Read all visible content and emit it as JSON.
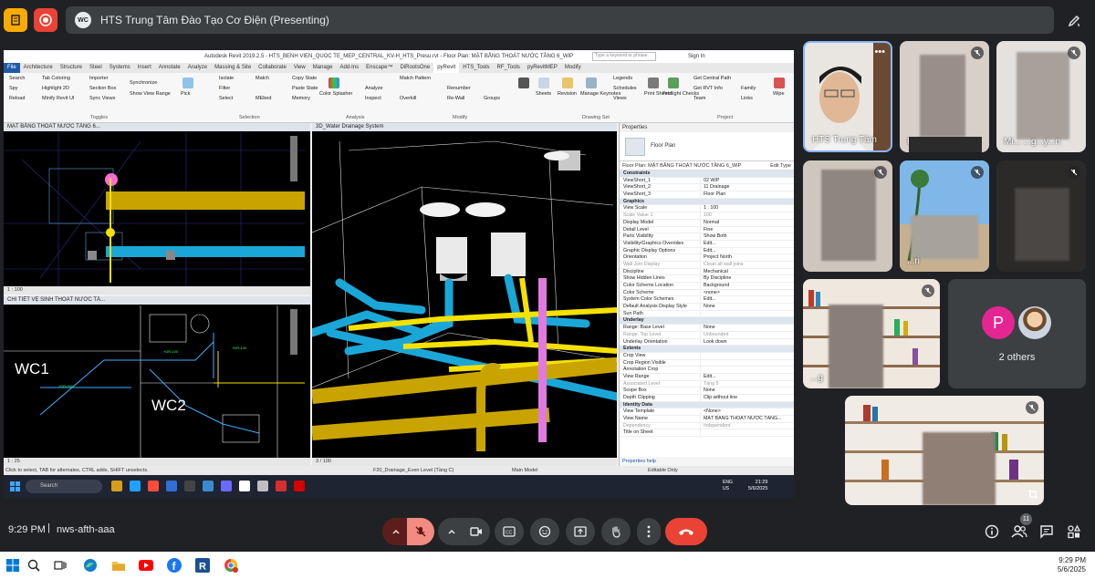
{
  "meet": {
    "title": "HTS Trung Tâm Đào Tạo Cơ Điện (Presenting)",
    "host_badge": "WC",
    "time": "9:29 PM",
    "separator": "|",
    "meeting_code": "nws-afth-aaa",
    "people_count": "11",
    "others_label": "2 others",
    "others_avatar_letter": "P",
    "participants": [
      {
        "name": "HTS Trung Tâm",
        "muted": false
      },
      {
        "name": "I",
        "muted": true
      },
      {
        "name": "Mi... ...g...y...n",
        "muted": true
      },
      {
        "name": "",
        "muted": true
      },
      {
        "name": "...ri",
        "muted": true
      },
      {
        "name": "",
        "muted": true
      },
      {
        "name": "...g",
        "muted": true
      },
      {
        "name": "",
        "muted": true
      }
    ]
  },
  "revit": {
    "window_title": "Autodesk Revit 2019.2.5 - HTS_BENH VIEN_QUOC TE_MEP_CENTRAL_KV-H_HTS_Presu.rvt - Floor Plan: MẶT BẰNG THOÁT NƯỚC TẦNG 6_WIP",
    "search_placeholder": "Type a keyword or phrase",
    "sign_in": "Sign In",
    "tabs": [
      "File",
      "Architecture",
      "Structure",
      "Steel",
      "Systems",
      "Insert",
      "Annotate",
      "Analyze",
      "Massing & Site",
      "Collaborate",
      "View",
      "Manage",
      "Add-Ins",
      "Enscape™",
      "DiRootsOne",
      "pyRevit",
      "HTS_Tools",
      "RF_Tools",
      "pyRevitMEP",
      "Modify"
    ],
    "active_tab": "pyRevit",
    "ribbon_groups": [
      "Toggles",
      "Selection",
      "Analysis",
      "Modify",
      "Drawing Set",
      "Project"
    ],
    "ribbon_items": {
      "toggles": [
        "Search",
        "Spy",
        "Reload",
        "Tab Coloring",
        "Highlight 2D",
        "Minify Revit UI",
        "Importer",
        "Section Box",
        "Sync Views",
        "Synchronize",
        "Show View Range"
      ],
      "selection": [
        "Isolate",
        "Filter",
        "Select",
        "Pick",
        "Match",
        "MEbed"
      ],
      "analysis": [
        "Copy State",
        "Paste State",
        "Memory",
        "Color Splasher",
        "Analyze",
        "Inspect",
        "Overkill",
        "Match Pattern"
      ],
      "modify": [
        "Renumber",
        "Re-Wall",
        "Groups"
      ],
      "drawing": [
        "Sheets",
        "Revision",
        "Manage Keynotes",
        "Legends",
        "Schedules",
        "Views",
        "Print Sheets",
        "Preflight Checks"
      ],
      "project": [
        "Get Central Path",
        "Get RVT Info",
        "Family",
        "Links",
        "Wipe",
        "Team"
      ]
    },
    "views": {
      "top_left": "MẶT BẰNG THOÁT NƯỚC TẦNG 6...",
      "bottom_left": "CHI TIẾT VỆ SINH THOÁT NƯỚC TẦ...",
      "main": "3D_Water Drainage System",
      "scale_1": "1 : 100",
      "scale_2": "1 : 25",
      "scale_3": "3 / 100",
      "wc1": "WC1",
      "wc2": "WC2"
    },
    "properties": {
      "title": "Properties",
      "type_name": "Floor Plan",
      "instance": "Floor Plan: MẶT BẰNG THOÁT NƯỚC TẦNG 6_WIP",
      "edit_type": "Edit Type",
      "help": "Properties help",
      "apply": "Apply",
      "rows": [
        {
          "k": "Constraints",
          "v": "",
          "section": true
        },
        {
          "k": "ViewShort_1",
          "v": "02 WIP"
        },
        {
          "k": "ViewShort_2",
          "v": "11 Drainage"
        },
        {
          "k": "ViewShort_3",
          "v": "Floor Plan"
        },
        {
          "k": "Graphics",
          "v": "",
          "section": true
        },
        {
          "k": "View Scale",
          "v": "1 : 100"
        },
        {
          "k": "Scale Value 1:",
          "v": "100",
          "grey": true
        },
        {
          "k": "Display Model",
          "v": "Normal"
        },
        {
          "k": "Detail Level",
          "v": "Fine"
        },
        {
          "k": "Parts Visibility",
          "v": "Show Both"
        },
        {
          "k": "Visibility/Graphics Overrides",
          "v": "Edit..."
        },
        {
          "k": "Graphic Display Options",
          "v": "Edit..."
        },
        {
          "k": "Orientation",
          "v": "Project North"
        },
        {
          "k": "Wall Join Display",
          "v": "Clean all wall joins",
          "grey": true
        },
        {
          "k": "Discipline",
          "v": "Mechanical"
        },
        {
          "k": "Show Hidden Lines",
          "v": "By Discipline"
        },
        {
          "k": "Color Scheme Location",
          "v": "Background"
        },
        {
          "k": "Color Scheme",
          "v": "<none>"
        },
        {
          "k": "System Color Schemes",
          "v": "Edit..."
        },
        {
          "k": "Default Analysis Display Style",
          "v": "None"
        },
        {
          "k": "Sun Path",
          "v": ""
        },
        {
          "k": "Underlay",
          "v": "",
          "section": true
        },
        {
          "k": "Range: Base Level",
          "v": "None"
        },
        {
          "k": "Range: Top Level",
          "v": "Unbounded",
          "grey": true
        },
        {
          "k": "Underlay Orientation",
          "v": "Look down"
        },
        {
          "k": "Extents",
          "v": "",
          "section": true
        },
        {
          "k": "Crop View",
          "v": ""
        },
        {
          "k": "Crop Region Visible",
          "v": ""
        },
        {
          "k": "Annotation Crop",
          "v": ""
        },
        {
          "k": "View Range",
          "v": "Edit..."
        },
        {
          "k": "Associated Level",
          "v": "Tầng 5",
          "grey": true
        },
        {
          "k": "Scope Box",
          "v": "None"
        },
        {
          "k": "Depth Clipping",
          "v": "Clip without line"
        },
        {
          "k": "Identity Data",
          "v": "",
          "section": true
        },
        {
          "k": "View Template",
          "v": "<None>"
        },
        {
          "k": "View Name",
          "v": "MẶT BẰNG THOÁT NƯỚC TẦNG..."
        },
        {
          "k": "Dependency",
          "v": "Independent",
          "grey": true
        },
        {
          "k": "Title on Sheet",
          "v": ""
        }
      ]
    },
    "status_bar": "Click to select, TAB for alternates, CTRL adds, SHIFT unselects.",
    "status_level": "F20_Drainage_Even Level (Tầng C)",
    "status_model": "Main Model",
    "status_editable": "Editable Only",
    "win_search": "Search",
    "tray_lang": "ENG",
    "tray_region": "US",
    "clock_time": "21:29",
    "clock_date": "5/6/2025"
  },
  "host_taskbar": {
    "time": "9:29 PM",
    "date": "5/6/2025"
  },
  "colors": {
    "meet_bg": "#202124",
    "pill": "#3c4043",
    "hangup": "#ea4335",
    "pipe_yellow": "#f5e100",
    "pipe_cyan": "#1aa7d8",
    "pipe_gold": "#c9a400",
    "pipe_magenta": "#e07ae0"
  }
}
